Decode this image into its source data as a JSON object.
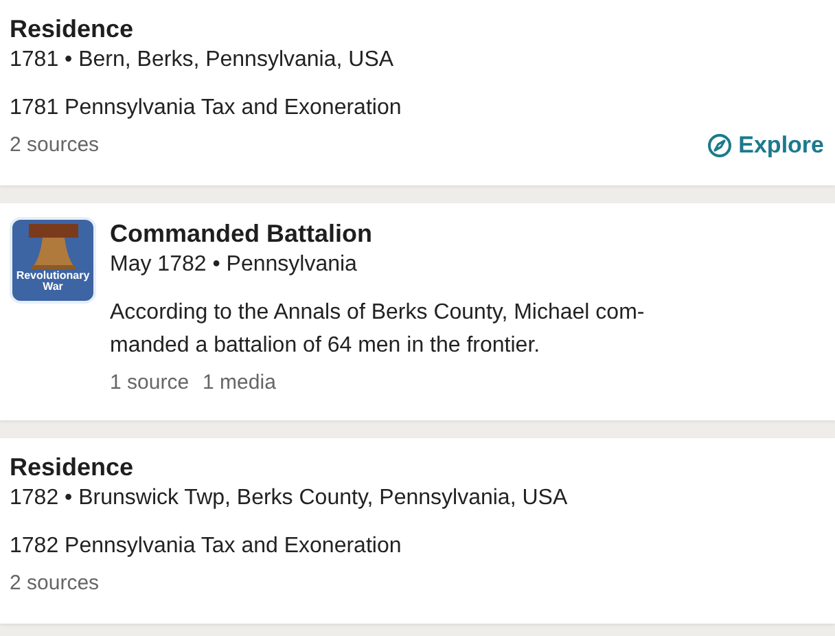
{
  "separator": "•",
  "events": [
    {
      "kind": "fact",
      "title": "Residence",
      "date": "1781",
      "place": "Bern, Berks, Pennsylvania, USA",
      "description": "1781 Pennsylvania Tax and Exoneration",
      "meta": [
        "2 sources"
      ],
      "action": "Explore"
    },
    {
      "kind": "story",
      "title": "Commanded Battalion",
      "date": "May 1782",
      "place": "Pennsylvania",
      "badge_text": "Revolutionary War",
      "description_lines": [
        "According to the Annals of Berks County, Michael com-",
        "manded a battalion of 64 men in the frontier."
      ],
      "meta": [
        "1 source",
        "1 media"
      ]
    },
    {
      "kind": "fact",
      "title": "Residence",
      "date": "1782",
      "place": "Brunswick Twp, Berks County, Pennsylvania, USA",
      "description": "1782 Pennsylvania Tax and Exoneration",
      "meta": [
        "2 sources"
      ]
    }
  ]
}
